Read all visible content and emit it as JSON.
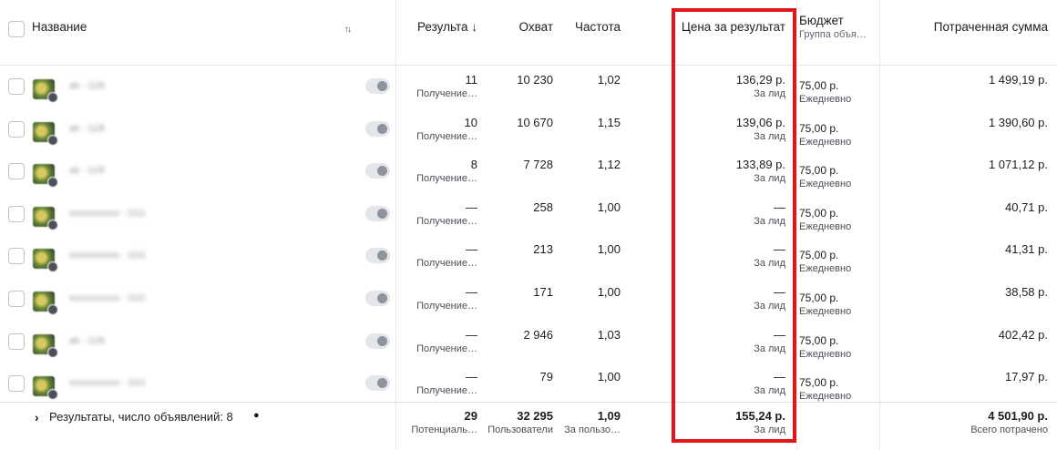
{
  "header": {
    "name_label": "Название",
    "sort_icon": "↑↓",
    "results_label": "Результа ↓",
    "reach_label": "Охват",
    "frequency_label": "Частота",
    "cost_per_result_label": "Цена за результат",
    "budget_label": "Бюджет",
    "budget_sub": "Группа объя…",
    "spent_label": "Потраченная сумма"
  },
  "rows": [
    {
      "name": "ab - 11/8",
      "results": "11",
      "results_sub": "Получение…",
      "reach": "10 230",
      "frequency": "1,02",
      "cost": "136,29 р.",
      "cost_sub": "За лид",
      "budget": "75,00 р.",
      "budget_sub": "Ежедневно",
      "spent": "1 499,19 р."
    },
    {
      "name": "ab - 11/8",
      "results": "10",
      "results_sub": "Получение…",
      "reach": "10 670",
      "frequency": "1,15",
      "cost": "139,06 р.",
      "cost_sub": "За лид",
      "budget": "75,00 р.",
      "budget_sub": "Ежедневно",
      "spent": "1 390,60 р."
    },
    {
      "name": "ab - 11/8",
      "results": "8",
      "results_sub": "Получение…",
      "reach": "7 728",
      "frequency": "1,12",
      "cost": "133,89 р.",
      "cost_sub": "За лид",
      "budget": "75,00 р.",
      "budget_sub": "Ежедневно",
      "spent": "1 071,12 р."
    },
    {
      "name": "xxxxxxxxxxx - 1111",
      "results": "—",
      "results_sub": "Получение…",
      "reach": "258",
      "frequency": "1,00",
      "cost": "—",
      "cost_sub": "За лид",
      "budget": "75,00 р.",
      "budget_sub": "Ежедневно",
      "spent": "40,71 р."
    },
    {
      "name": "xxxxxxxxxxx - 1111",
      "results": "—",
      "results_sub": "Получение…",
      "reach": "213",
      "frequency": "1,00",
      "cost": "—",
      "cost_sub": "За лид",
      "budget": "75,00 р.",
      "budget_sub": "Ежедневно",
      "spent": "41,31 р."
    },
    {
      "name": "xxxxxxxxxxx - 1111",
      "results": "—",
      "results_sub": "Получение…",
      "reach": "171",
      "frequency": "1,00",
      "cost": "—",
      "cost_sub": "За лид",
      "budget": "75,00 р.",
      "budget_sub": "Ежедневно",
      "spent": "38,58 р."
    },
    {
      "name": "ab - 11/8",
      "results": "—",
      "results_sub": "Получение…",
      "reach": "2 946",
      "frequency": "1,03",
      "cost": "—",
      "cost_sub": "За лид",
      "budget": "75,00 р.",
      "budget_sub": "Ежедневно",
      "spent": "402,42 р."
    },
    {
      "name": "xxxxxxxxxxx - 1111",
      "results": "—",
      "results_sub": "Получение…",
      "reach": "79",
      "frequency": "1,00",
      "cost": "—",
      "cost_sub": "За лид",
      "budget": "75,00 р.",
      "budget_sub": "Ежедневно",
      "spent": "17,97 р."
    }
  ],
  "footer": {
    "chevron": "›",
    "label": "Результаты, число объявлений: 8",
    "info_icon": "●",
    "results": "29",
    "results_sub": "Потенциаль…",
    "reach": "32 295",
    "reach_sub": "Пользователи",
    "frequency": "1,09",
    "frequency_sub": "За пользо…",
    "cost": "155,24 р.",
    "cost_sub": "За лид",
    "spent": "4 501,90 р.",
    "spent_sub": "Всего потрачено"
  },
  "colors": {
    "highlight": "#e0161b",
    "border": "#e4e6eb"
  }
}
